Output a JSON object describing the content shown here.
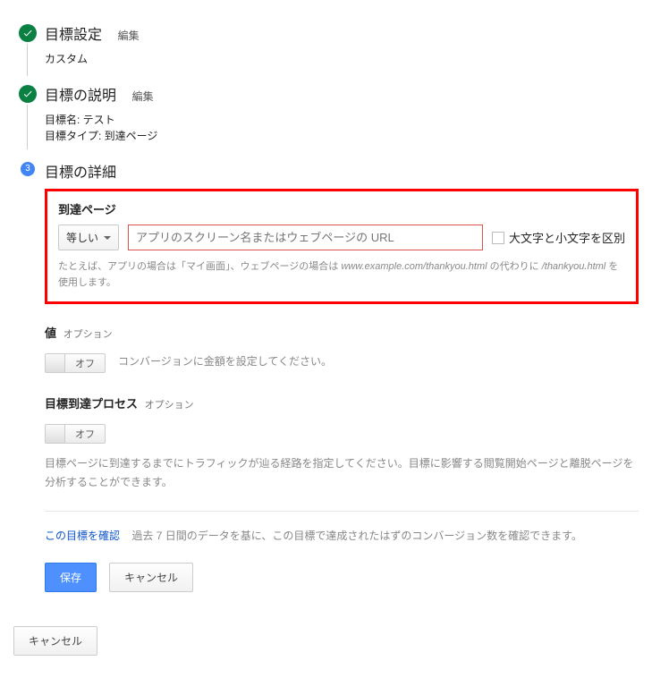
{
  "steps": {
    "s1": {
      "title": "目標設定",
      "edit": "編集",
      "sub": "カスタム"
    },
    "s2": {
      "title": "目標の説明",
      "edit": "編集",
      "name_label": "目標名: テスト",
      "type_label": "目標タイプ: 到達ページ"
    },
    "s3": {
      "num": "3",
      "title": "目標の詳細"
    }
  },
  "destination": {
    "label": "到達ページ",
    "match_type": "等しい",
    "url_placeholder": "アプリのスクリーン名またはウェブページの URL",
    "case_label": "大文字と小文字を区別",
    "help_prefix": "たとえば、アプリの場合は「マイ画面」、ウェブページの場合は ",
    "help_url": "www.example.com/thankyou.html",
    "help_mid": " の代わりに ",
    "help_path": "/thankyou.html",
    "help_suffix": " を使用します。"
  },
  "value_section": {
    "title": "値",
    "opt": "オプション",
    "toggle_off": "オフ",
    "desc": "コンバージョンに金額を設定してください。"
  },
  "funnel_section": {
    "title": "目標到達プロセス",
    "opt": "オプション",
    "toggle_off": "オフ",
    "desc": "目標ページに到達するまでにトラフィックが辿る経路を指定してください。目標に影響する閲覧開始ページと離脱ページを分析することができます。"
  },
  "verify": {
    "link": "この目標を確認",
    "text": "過去 7 日間のデータを基に、この目標で達成されたはずのコンバージョン数を確認できます。"
  },
  "buttons": {
    "save": "保存",
    "cancel": "キャンセル",
    "footer_cancel": "キャンセル"
  }
}
